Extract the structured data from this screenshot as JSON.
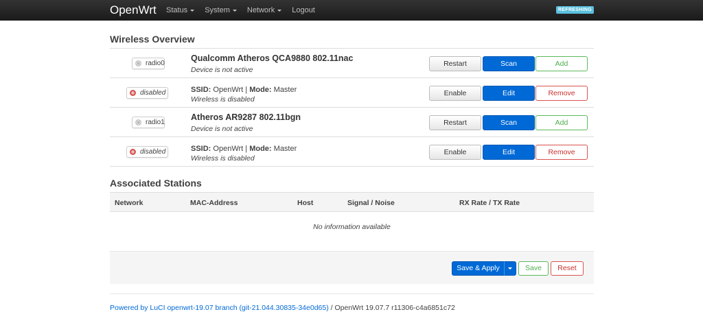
{
  "header": {
    "brand": "OpenWrt",
    "nav": [
      {
        "label": "Status",
        "has_menu": true
      },
      {
        "label": "System",
        "has_menu": true
      },
      {
        "label": "Network",
        "has_menu": true
      },
      {
        "label": "Logout",
        "has_menu": false
      }
    ],
    "refresh_badge": "REFRESHING"
  },
  "wireless": {
    "heading": "Wireless Overview",
    "rows": [
      {
        "type": "device",
        "badge": "radio0",
        "title": "Qualcomm Atheros QCA9880 802.11nac",
        "status": "Device is not active",
        "buttons": [
          "Restart",
          "Scan",
          "Add"
        ]
      },
      {
        "type": "iface",
        "badge": "disabled",
        "ssid_label": "SSID:",
        "ssid": "OpenWrt",
        "sep": "|",
        "mode_label": "Mode:",
        "mode": "Master",
        "status": "Wireless is disabled",
        "buttons": [
          "Enable",
          "Edit",
          "Remove"
        ]
      },
      {
        "type": "device",
        "badge": "radio1",
        "title": "Atheros AR9287 802.11bgn",
        "status": "Device is not active",
        "buttons": [
          "Restart",
          "Scan",
          "Add"
        ]
      },
      {
        "type": "iface",
        "badge": "disabled",
        "ssid_label": "SSID:",
        "ssid": "OpenWrt",
        "sep": "|",
        "mode_label": "Mode:",
        "mode": "Master",
        "status": "Wireless is disabled",
        "buttons": [
          "Enable",
          "Edit",
          "Remove"
        ]
      }
    ]
  },
  "stations": {
    "heading": "Associated Stations",
    "columns": [
      "Network",
      "MAC-Address",
      "Host",
      "Signal / Noise",
      "RX Rate / TX Rate"
    ],
    "empty_text": "No information available"
  },
  "actions": {
    "save_apply": "Save & Apply",
    "save": "Save",
    "reset": "Reset"
  },
  "footer": {
    "link_text": "Powered by LuCI openwrt-19.07 branch (git-21.044.30835-34e0d65)",
    "version_text": " / OpenWrt 19.07.7 r11306-c4a6851c72"
  },
  "colors": {
    "accent": "#0069d6",
    "topbar": "#222222",
    "badge": "#5bc0de",
    "success": "#5cb85c",
    "danger": "#d9534f"
  }
}
